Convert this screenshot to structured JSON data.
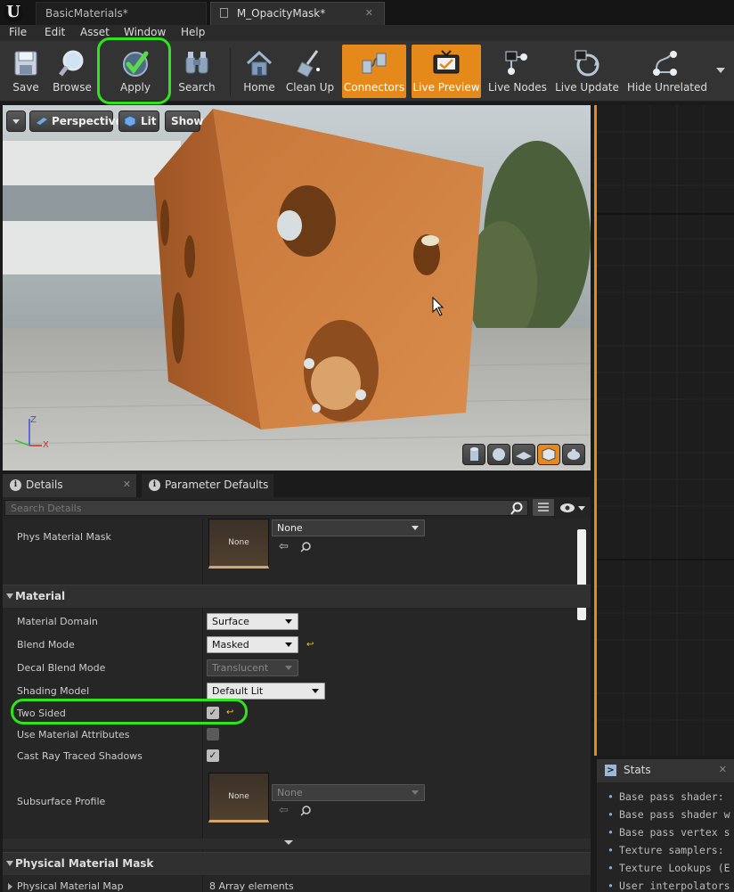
{
  "titlebar": {
    "tabs": [
      {
        "label": "BasicMaterials*"
      },
      {
        "label": "M_OpacityMask*"
      }
    ]
  },
  "menu": [
    "File",
    "Edit",
    "Asset",
    "Window",
    "Help"
  ],
  "toolbar": {
    "buttons": [
      {
        "label": "Save",
        "icon": "floppy-disk-icon"
      },
      {
        "label": "Browse",
        "icon": "magnifier-icon"
      },
      {
        "label": "Apply",
        "icon": "checkmark-icon"
      },
      {
        "label": "Search",
        "icon": "binoculars-icon"
      },
      {
        "label": "Home",
        "icon": "house-icon"
      },
      {
        "label": "Clean Up",
        "icon": "broom-icon"
      },
      {
        "label": "Connectors",
        "icon": "connectors-icon",
        "active": true
      },
      {
        "label": "Live Preview",
        "icon": "tv-icon",
        "active": true
      },
      {
        "label": "Live Nodes",
        "icon": "live-nodes-icon"
      },
      {
        "label": "Live Update",
        "icon": "refresh-clock-icon"
      },
      {
        "label": "Hide Unrelated",
        "icon": "branch-icon"
      }
    ],
    "accent": "#e5891a"
  },
  "viewport": {
    "perspective_label": "Perspective",
    "lit_label": "Lit",
    "show_label": "Show",
    "axis": {
      "z": "Z",
      "x": "X"
    }
  },
  "details": {
    "tabs": [
      {
        "label": "Details"
      },
      {
        "label": "Parameter Defaults"
      }
    ],
    "search_placeholder": "Search Details",
    "phys_material_mask": {
      "label": "Phys Material Mask",
      "thumb": "None",
      "value": "None"
    },
    "material_section": "Material",
    "rows": {
      "material_domain": {
        "label": "Material Domain",
        "value": "Surface"
      },
      "blend_mode": {
        "label": "Blend Mode",
        "value": "Masked"
      },
      "decal_blend_mode": {
        "label": "Decal Blend Mode",
        "value": "Translucent"
      },
      "shading_model": {
        "label": "Shading Model",
        "value": "Default Lit"
      },
      "two_sided": {
        "label": "Two Sided",
        "checked": true
      },
      "use_material_attributes": {
        "label": "Use Material Attributes",
        "checked": false
      },
      "cast_ray_traced_shadows": {
        "label": "Cast Ray Traced Shadows",
        "checked": true
      },
      "subsurface_profile": {
        "label": "Subsurface Profile",
        "thumb": "None",
        "value": "None"
      }
    },
    "physical_material_mask_section": "Physical Material Mask",
    "physical_material_map": {
      "label": "Physical Material Map",
      "value": "8 Array elements"
    }
  },
  "stats": {
    "title": "Stats",
    "lines": [
      "Base pass shader:",
      "Base pass shader w",
      "Base pass vertex s",
      "Texture samplers:",
      "Texture Lookups (E",
      "User interpolators"
    ]
  },
  "highlight_color": "#2ee51c"
}
